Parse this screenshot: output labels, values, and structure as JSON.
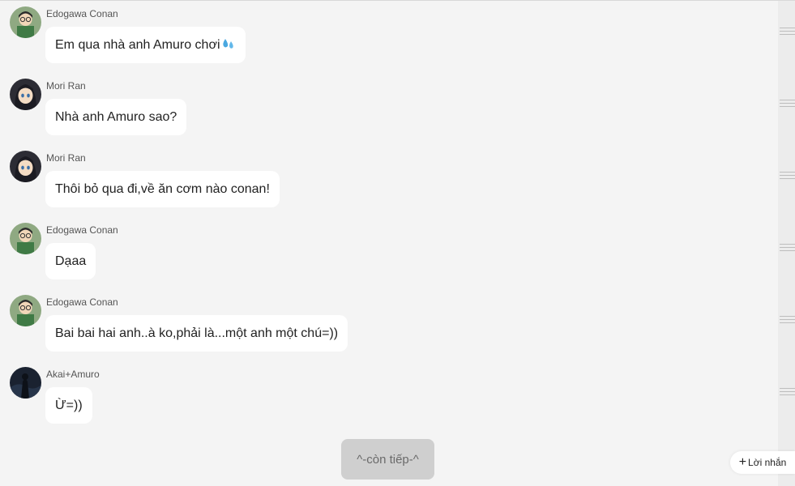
{
  "messages": [
    {
      "sender": "Edogawa Conan",
      "avatar": "conan-avatar",
      "text": "Em qua nhà anh Amuro chơi",
      "emoji": "sweat-droplets-icon"
    },
    {
      "sender": "Mori Ran",
      "avatar": "ran-avatar",
      "text": "Nhà anh Amuro sao?"
    },
    {
      "sender": "Mori Ran",
      "avatar": "ran-avatar",
      "text": "Thôi bỏ qua đi,về ăn cơm nào conan!"
    },
    {
      "sender": "Edogawa Conan",
      "avatar": "conan-avatar",
      "text": "Dạaa"
    },
    {
      "sender": "Edogawa Conan",
      "avatar": "conan-avatar",
      "text": "Bai bai hai anh..à ko,phải là...một anh một chú=))"
    },
    {
      "sender": "Akai+Amuro",
      "avatar": "akai-amuro-avatar",
      "text": "Ừ=))"
    }
  ],
  "more_button": {
    "label": "^-còn tiếp-^"
  },
  "note_button": {
    "label": "Lời nhắn",
    "icon": "plus-icon"
  },
  "colors": {
    "background": "#f4f4f4",
    "bubble": "#ffffff",
    "more_button": "#cfcfcf"
  }
}
